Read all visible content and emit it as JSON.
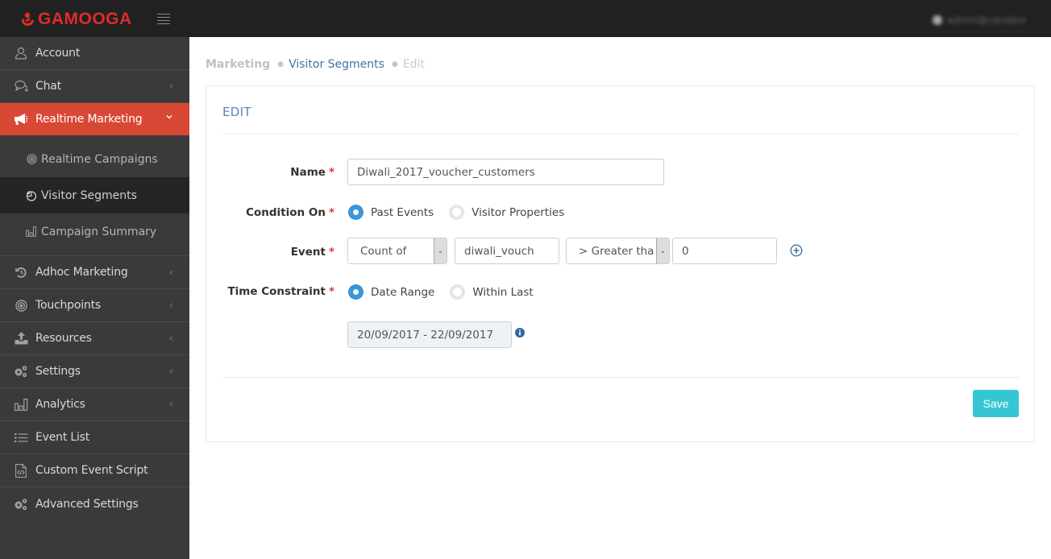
{
  "app": {
    "brand": "GAMOOGA",
    "brand_color": "#e02b2b",
    "user": "admin@candare"
  },
  "sidebar": {
    "items": [
      {
        "label": "Account",
        "icon": "user-icon",
        "has_chevron": false
      },
      {
        "label": "Chat",
        "icon": "chat-icon",
        "has_chevron": true
      },
      {
        "label": "Realtime Marketing",
        "icon": "megaphone-icon",
        "has_chevron": true,
        "expanded": true,
        "active": true,
        "children": [
          {
            "label": "Realtime Campaigns",
            "icon": "target-icon"
          },
          {
            "label": "Visitor Segments",
            "icon": "pie-chart-icon",
            "current": true
          },
          {
            "label": "Campaign Summary",
            "icon": "bar-chart-icon"
          }
        ]
      },
      {
        "label": "Adhoc Marketing",
        "icon": "history-icon",
        "has_chevron": true
      },
      {
        "label": "Touchpoints",
        "icon": "target-icon",
        "has_chevron": true
      },
      {
        "label": "Resources",
        "icon": "upload-icon",
        "has_chevron": true
      },
      {
        "label": "Settings",
        "icon": "gears-icon",
        "has_chevron": true
      },
      {
        "label": "Analytics",
        "icon": "bar-chart-icon",
        "has_chevron": true
      },
      {
        "label": "Event List",
        "icon": "list-icon",
        "has_chevron": false
      },
      {
        "label": "Custom Event Script",
        "icon": "code-file-icon",
        "has_chevron": false
      },
      {
        "label": "Advanced Settings",
        "icon": "gears-icon",
        "has_chevron": false
      }
    ],
    "active_color": "#d94735"
  },
  "breadcrumb": {
    "root": "Marketing",
    "link": "Visitor Segments",
    "current": "Edit"
  },
  "form": {
    "title": "EDIT",
    "name": {
      "label": "Name",
      "value": "Diwali_2017_voucher_customers"
    },
    "condition_on": {
      "label": "Condition On",
      "options": [
        "Past Events",
        "Visitor Properties"
      ],
      "selected": "Past Events"
    },
    "event": {
      "label": "Event",
      "aggregate": "Count of",
      "event_name": "diwali_vouch",
      "operator": "> Greater tha",
      "value": "0"
    },
    "time_constraint": {
      "label": "Time Constraint",
      "options": [
        "Date Range",
        "Within Last"
      ],
      "selected": "Date Range",
      "date_range": "20/09/2017 - 22/09/2017"
    },
    "required_marker": "*",
    "save_label": "Save",
    "save_color": "#36c6d3",
    "radio_color": "#3b96d9"
  }
}
